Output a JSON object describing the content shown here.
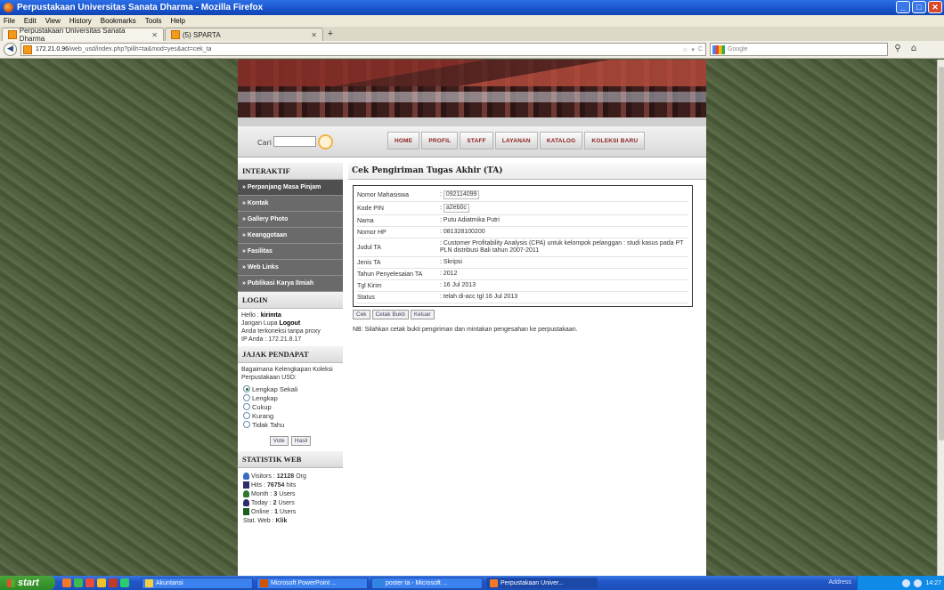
{
  "window": {
    "title": "Perpustakaan Universitas Sanata Dharma - Mozilla Firefox"
  },
  "menu": [
    "File",
    "Edit",
    "View",
    "History",
    "Bookmarks",
    "Tools",
    "Help"
  ],
  "tabs": [
    {
      "label": "Perpustakaan Universitas Sanata Dharma",
      "active": true
    },
    {
      "label": "(5) SPARTA",
      "active": false
    }
  ],
  "address": {
    "host": "172.21.0.96",
    "path": "/web_usd/index.php?pilih=ta&mod=yes&act=cek_ta",
    "search_placeholder": "Google"
  },
  "site": {
    "search_label": "Cari",
    "nav": [
      "HOME",
      "PROFIL",
      "STAFF",
      "LAYANAN",
      "KATALOG",
      "KOLEKSI BARU"
    ],
    "sidebar": {
      "interaktif_title": "INTERAKTIF",
      "interaktif_items": [
        "Perpanjang Masa Pinjam",
        "Kontak",
        "Gallery Photo",
        "Keanggotaan",
        "Fasilitas",
        "Web Links",
        "Publikasi Karya Ilmiah"
      ],
      "login_title": "LOGIN",
      "login_hello": "Hello : ",
      "login_user": "kirimta",
      "login_reminder_a": "Jangan Lupa ",
      "login_logout": "Logout",
      "login_line2": "Anda terkoneksi tanpa proxy",
      "login_ip": "IP Anda : 172.21.8.17",
      "poll_title": "JAJAK PENDAPAT",
      "poll_question": "Bagaimana Kelengkapan Koleksi Perpustakaan USD:",
      "poll_options": [
        "Lengkap Sekali",
        "Lengkap",
        "Cukup",
        "Kurang",
        "Tidak Tahu"
      ],
      "poll_selected": 0,
      "poll_vote": "Vote",
      "poll_result": "Hasil",
      "stat_title": "STATISTIK WEB",
      "stats": [
        {
          "label": "Visitors : ",
          "value": "12128",
          "unit": " Org"
        },
        {
          "label": "Hits : ",
          "value": "76754",
          "unit": " hits"
        },
        {
          "label": "Month : ",
          "value": "3",
          "unit": " Users"
        },
        {
          "label": "Today : ",
          "value": "2",
          "unit": " Users"
        },
        {
          "label": "Online : ",
          "value": "1",
          "unit": " Users"
        }
      ],
      "stat_web_label": "Stat. Web : ",
      "stat_web_link": "Klik"
    },
    "main": {
      "title": "Cek Pengiriman Tugas Akhir (TA)",
      "fields": [
        {
          "label": "Nomor Mahasiswa",
          "value": "092114099",
          "boxed": true
        },
        {
          "label": "Kode PIN",
          "value": "a2eb0c",
          "boxed": true
        },
        {
          "label": "Nama",
          "value": "Putu Adiatmika Putri",
          "boxed": false
        },
        {
          "label": "Nomor HP",
          "value": "081328100200",
          "boxed": false
        },
        {
          "label": "Judul TA",
          "value": "Customer Profitability Analysis (CPA) untuk kelompok pelanggan : studi kasus pada PT PLN distribusi Bali tahun 2007-2011",
          "boxed": false
        },
        {
          "label": "Jenis TA",
          "value": "Skripsi",
          "boxed": false
        },
        {
          "label": "Tahun Penyelesaian TA",
          "value": "2012",
          "boxed": false
        },
        {
          "label": "Tgl Kirim",
          "value": "16 Jul 2013",
          "boxed": false
        },
        {
          "label": "Status",
          "value": "telah di-acc tgl 16 Jul 2013",
          "boxed": false
        }
      ],
      "buttons": [
        "Cek",
        "Cetak Bukti",
        "Keluar"
      ],
      "note": "NB: Silahkan cetak bukti pengiriman dan mintakan pengesahan ke perpustakaan."
    }
  },
  "taskbar": {
    "start": "start",
    "items": [
      "Akuntansi",
      "Microsoft PowerPoint ...",
      "poster ta - Microsoft ...",
      "Perpustakaan Univer..."
    ],
    "address_label": "Address",
    "clock": "14:27"
  }
}
